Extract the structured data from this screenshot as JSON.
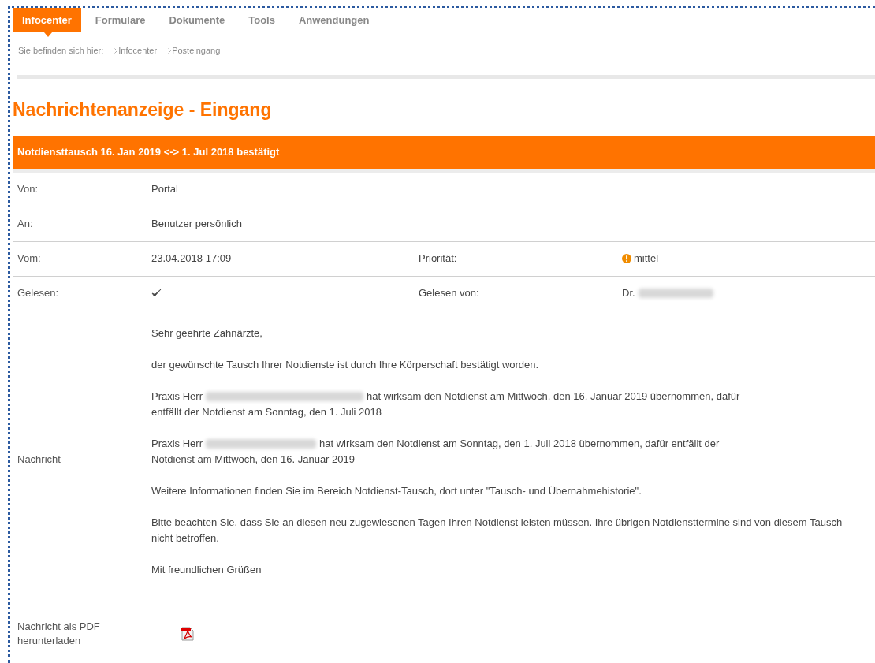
{
  "tabs": [
    {
      "label": "Infocenter",
      "selected": true
    },
    {
      "label": "Formulare",
      "selected": false
    },
    {
      "label": "Dokumente",
      "selected": false
    },
    {
      "label": "Tools",
      "selected": false
    },
    {
      "label": "Anwendungen",
      "selected": false
    }
  ],
  "breadcrumb": {
    "label": "Sie befinden sich hier:",
    "items": [
      "Infocenter",
      "Posteingang"
    ]
  },
  "page_title": "Nachrichtenanzeige - Eingang",
  "message": {
    "subject": "Notdiensttausch 16. Jan 2019 <-> 1. Jul 2018 bestätigt",
    "from_label": "Von:",
    "from": "Portal",
    "to_label": "An:",
    "to": "Benutzer persönlich",
    "date_label": "Vom:",
    "date": "23.04.2018 17:09",
    "priority_label": "Priorität:",
    "priority": "mittel",
    "priority_icon": true,
    "read_label": "Gelesen:",
    "read": true,
    "read_by_label": "Gelesen von:",
    "read_by": "Dr.",
    "read_by_redacted": true,
    "body_label": "Nachricht",
    "body": [
      {
        "kind": "plain",
        "text": "Sehr geehrte Zahnärzte,"
      },
      {
        "kind": "plain",
        "text": "der gewünschte Tausch Ihrer Notdienste ist durch Ihre Körperschaft bestätigt worden."
      },
      {
        "kind": "redacted",
        "before": "Praxis Herr",
        "after": "hat wirksam den Notdienst am Mittwoch, den 16. Januar 2019 übernommen, dafür",
        "continuation": "entfällt der Notdienst am Sonntag, den 1. Juli 2018"
      },
      {
        "kind": "redacted",
        "before": "Praxis Herr",
        "after": "hat wirksam den Notdienst am Sonntag, den 1. Juli 2018 übernommen, dafür entfällt der",
        "continuation": "Notdienst am Mittwoch, den 16. Januar 2019"
      },
      {
        "kind": "plain",
        "text": "Weitere Informationen finden Sie im Bereich Notdienst-Tausch, dort unter \"Tausch- und Übernahmehistorie\"."
      },
      {
        "kind": "plain",
        "text": "Bitte beachten Sie, dass Sie an diesen neu zugewiesenen Tagen Ihren Notdienst leisten müssen. Ihre übrigen Notdiensttermine sind von diesem Tausch nicht betroffen."
      },
      {
        "kind": "plain",
        "text": "Mit freundlichen Grüßen"
      }
    ],
    "pdf_label": "Nachricht als PDF herunterladen"
  }
}
